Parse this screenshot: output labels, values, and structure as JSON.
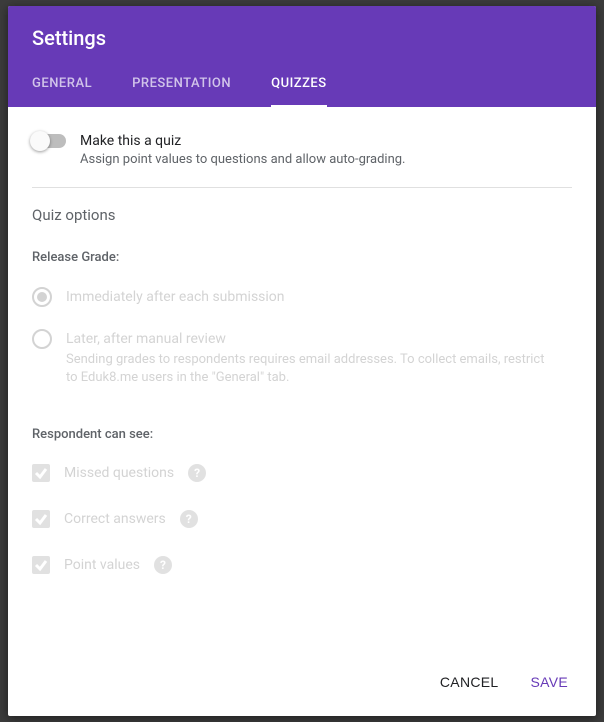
{
  "title": "Settings",
  "tabs": {
    "general": "GENERAL",
    "presentation": "PRESENTATION",
    "quizzes": "QUIZZES",
    "active": "quizzes"
  },
  "toggle": {
    "label": "Make this a quiz",
    "sub": "Assign point values to questions and allow auto-grading.",
    "on": false
  },
  "quiz_options_title": "Quiz options",
  "release_grade": {
    "label": "Release Grade:",
    "options": {
      "immediate": {
        "label": "Immediately after each submission",
        "selected": true
      },
      "later": {
        "label": "Later, after manual review",
        "sub": "Sending grades to respondents requires email addresses. To collect emails, restrict to Eduk8.me users in the \"General\" tab.",
        "selected": false
      }
    }
  },
  "respondent": {
    "label": "Respondent can see:",
    "missed": "Missed questions",
    "correct": "Correct answers",
    "points": "Point values"
  },
  "buttons": {
    "cancel": "CANCEL",
    "save": "SAVE"
  }
}
